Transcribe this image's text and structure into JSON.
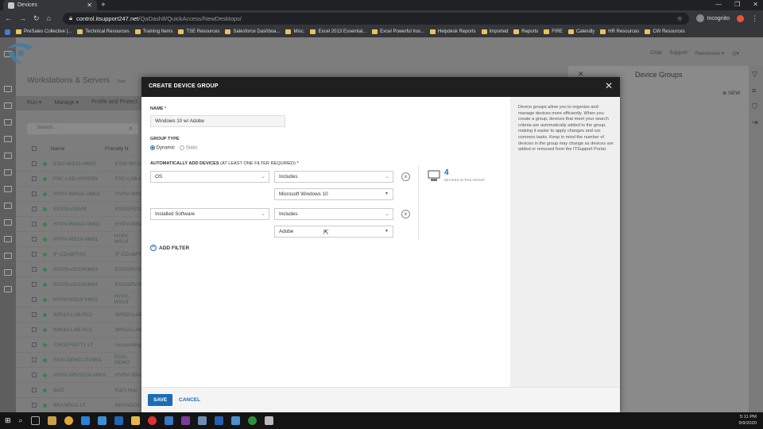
{
  "browser": {
    "tab_title": "Devices",
    "url_host": "control.itsupport247.net",
    "url_path": "/QaDash8/QuickAccess/NewDesktops/",
    "profile_label": "Incognito",
    "bookmarks": [
      "PreSales Collective |...",
      "Technical Resources",
      "Training Items",
      "TSE Resources",
      "Salesforce Dashboa...",
      "Misc.",
      "Excel 2013 Essential...",
      "Excel Powerful Insi...",
      "Helpdesk Reports",
      "Imported",
      "Reports",
      "FIRE",
      "Calendly",
      "HR Resources",
      "CW Resources"
    ]
  },
  "app": {
    "top_links": [
      "Chat",
      "Support",
      "Resources ▾"
    ],
    "page_title": "Workstations & Servers",
    "page_title_suffix": "Total",
    "toolbar": [
      "Run ▾",
      "Manage ▾",
      "Profile and Protect"
    ],
    "search_placeholder": "Search...",
    "columns": [
      "Name",
      "Friendly N"
    ],
    "devices": [
      [
        "ESXI-WS19-VM02",
        "ESXI-WS19"
      ],
      [
        "FSC-LAB-HYPER9",
        "FSC-LAB-H"
      ],
      [
        "HYPV-WIN10-VM03",
        "HYPV-WIN"
      ],
      [
        "ESXISrv19VM",
        "ESXISRV19"
      ],
      [
        "HYPV-WIN10-VM02",
        "HYPV-WIN"
      ],
      [
        "HYPV-WS19-VM01",
        "HYPV-WS19"
      ],
      [
        "IF-CDA8FFA0",
        "IF-CDA8FF"
      ],
      [
        "ESXISrv2019VM03",
        "ESXISRV20"
      ],
      [
        "ESXISrv2019VM04",
        "ESXISRV20"
      ],
      [
        "HYPV-WS19-VM02",
        "HYPV-WS19"
      ],
      [
        "WIN10-LAB-PC2",
        "WIN10-LAB"
      ],
      [
        "WIN10-LAB-PC1",
        "WIN10-LAB"
      ],
      [
        "TWOLFGITT1-LT",
        "Accounting"
      ],
      [
        "ESXI-DEMO-ITVM01",
        "ESXI-DEMO"
      ],
      [
        "HYPV-SRV2019-VM03",
        "HYPV-SRV"
      ],
      [
        "dv32",
        "Kat's Mac"
      ],
      [
        "BRANDO1-LT",
        "BRANDO1"
      ]
    ],
    "device_groups_panel": {
      "title": "Device Groups",
      "new_label": "NEW"
    }
  },
  "dialog": {
    "title": "CREATE DEVICE GROUP",
    "name_label": "NAME",
    "name_value": "Windows 10 w/ Adobe",
    "group_type_label": "GROUP TYPE",
    "group_type_options": [
      "Dynamic",
      "Static"
    ],
    "group_type_selected": "Dynamic",
    "filters_label": "AUTOMATICALLY ADD DEVICES",
    "filters_hint": "(AT LEAST ONE FILTER REQUIRED)",
    "filters": [
      {
        "field": "OS",
        "operator": "Includes",
        "value": "Microsoft Windows 10"
      },
      {
        "field": "Installed Software",
        "operator": "Includes",
        "value": "Adobe"
      }
    ],
    "device_count": "4",
    "device_count_label": "DEVICES IN THIS GROUP",
    "add_filter_label": "ADD FILTER",
    "help_text": "Device groups allow you to organize and manage devices more efficiently. When you create a group, devices that meet your search criteria are automatically added to the group, making it easier to apply changes and run common tasks. Keep in mind the number of devices in the group may change as devices are added or removed from the ITSupport Portal.",
    "save_label": "SAVE",
    "cancel_label": "CANCEL"
  },
  "taskbar": {
    "time": "5:11 PM",
    "date": "9/9/2020"
  },
  "colors": {
    "accent": "#1a6cb5",
    "dialog_header": "#1f1f1f",
    "overlay": "#7d7d7d"
  }
}
